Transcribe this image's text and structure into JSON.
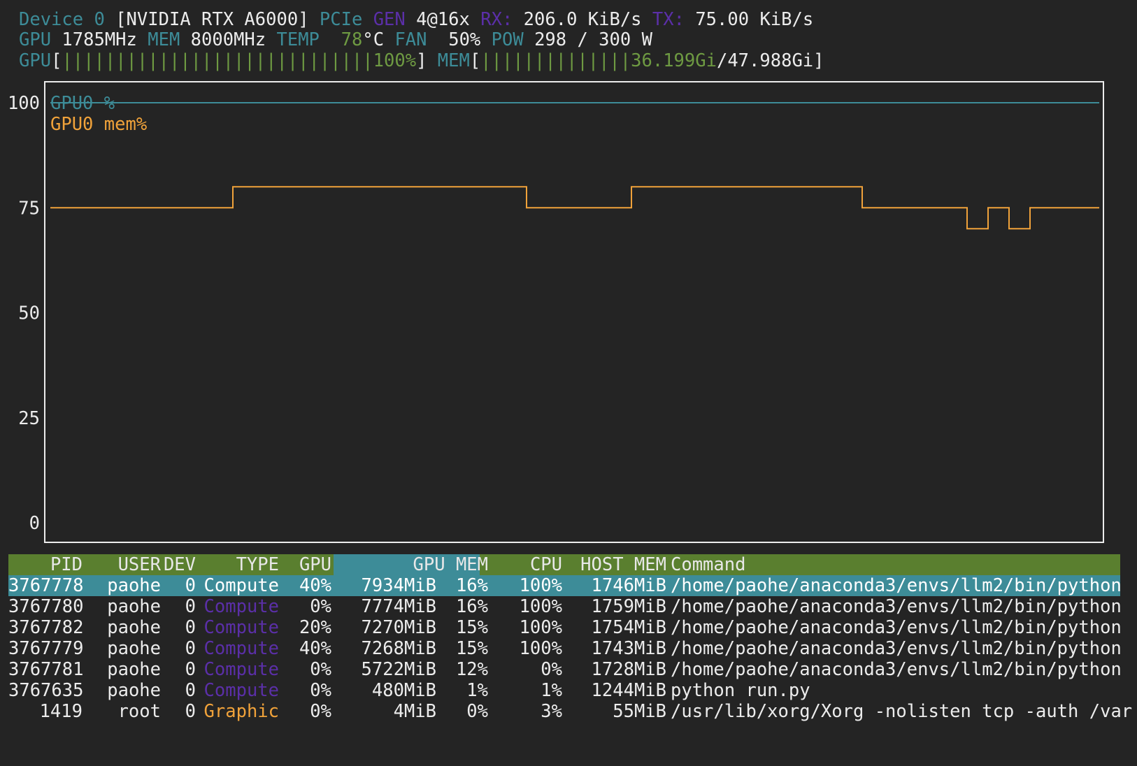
{
  "device": {
    "label": "Device",
    "index": "0",
    "name": "[NVIDIA RTX A6000]",
    "pcie_label": "PCIe",
    "gen_label": "GEN",
    "gen_value": "4@16x",
    "rx_label": "RX:",
    "rx_value": "206.0 KiB/s",
    "tx_label": "TX:",
    "tx_value": "75.00 KiB/s"
  },
  "stats": {
    "gpu_label": "GPU",
    "gpu_clock": "1785MHz",
    "mem_label": "MEM",
    "mem_clock": "8000MHz",
    "temp_label": "TEMP",
    "temp_value": "78",
    "temp_unit": "°C",
    "fan_label": "FAN",
    "fan_value": "50%",
    "pow_label": "POW",
    "pow_value": "298 / 300 W"
  },
  "bars": {
    "gpu_label": "GPU",
    "gpu_fill": "|||||||||||||||||||||||||||||",
    "gpu_percent": "100%",
    "gpu_level": 1.0,
    "mem_label": "MEM",
    "mem_fill": "||||||||||||||",
    "mem_used": "36.199Gi",
    "mem_total": "47.988Gi"
  },
  "chart_data": {
    "type": "line",
    "xlabel": "",
    "ylabel": "",
    "ylim": [
      0,
      100
    ],
    "yticks": [
      "100",
      "75",
      "50",
      "25",
      "0"
    ],
    "legend_placement": "top-left",
    "grid": false,
    "series": [
      {
        "name": "GPU0 %",
        "color": "#3d8c98",
        "x": [
          0,
          100
        ],
        "y": [
          100,
          100
        ]
      },
      {
        "name": "GPU0 mem%",
        "color": "#f0a23a",
        "x": [
          0,
          17.4,
          17.4,
          45.4,
          45.4,
          55.4,
          55.4,
          77.4,
          77.4,
          87.4,
          87.4,
          89.4,
          89.4,
          91.4,
          91.4,
          93.4,
          93.4,
          100
        ],
        "y": [
          75,
          75,
          80,
          80,
          75,
          75,
          80,
          80,
          75,
          75,
          70,
          70,
          75,
          75,
          70,
          70,
          75,
          75
        ]
      }
    ]
  },
  "process_table": {
    "headers": {
      "pid": "PID",
      "user": "USER",
      "dev": "DEV",
      "type": "TYPE",
      "gpu": "GPU",
      "gpu_mem": "GPU MEM",
      "mem_pct": "",
      "cpu": "CPU",
      "host_mem": "HOST MEM",
      "command": "Command"
    },
    "rows": [
      {
        "pid": "3767778",
        "user": "paohe",
        "dev": "0",
        "type": "Compute",
        "gpu": "40%",
        "gpu_mem": "7934MiB",
        "mem_pct": "16%",
        "cpu": "100%",
        "host_mem": "1746MiB",
        "command": "/home/paohe/anaconda3/envs/llm2/bin/python"
      },
      {
        "pid": "3767780",
        "user": "paohe",
        "dev": "0",
        "type": "Compute",
        "gpu": "0%",
        "gpu_mem": "7774MiB",
        "mem_pct": "16%",
        "cpu": "100%",
        "host_mem": "1759MiB",
        "command": "/home/paohe/anaconda3/envs/llm2/bin/python"
      },
      {
        "pid": "3767782",
        "user": "paohe",
        "dev": "0",
        "type": "Compute",
        "gpu": "20%",
        "gpu_mem": "7270MiB",
        "mem_pct": "15%",
        "cpu": "100%",
        "host_mem": "1754MiB",
        "command": "/home/paohe/anaconda3/envs/llm2/bin/python"
      },
      {
        "pid": "3767779",
        "user": "paohe",
        "dev": "0",
        "type": "Compute",
        "gpu": "40%",
        "gpu_mem": "7268MiB",
        "mem_pct": "15%",
        "cpu": "100%",
        "host_mem": "1743MiB",
        "command": "/home/paohe/anaconda3/envs/llm2/bin/python"
      },
      {
        "pid": "3767781",
        "user": "paohe",
        "dev": "0",
        "type": "Compute",
        "gpu": "0%",
        "gpu_mem": "5722MiB",
        "mem_pct": "12%",
        "cpu": "0%",
        "host_mem": "1728MiB",
        "command": "/home/paohe/anaconda3/envs/llm2/bin/python"
      },
      {
        "pid": "3767635",
        "user": "paohe",
        "dev": "0",
        "type": "Compute",
        "gpu": "0%",
        "gpu_mem": "480MiB",
        "mem_pct": "1%",
        "cpu": "1%",
        "host_mem": "1244MiB",
        "command": "python run.py"
      },
      {
        "pid": "1419",
        "user": "root",
        "dev": "0",
        "type": "Graphic",
        "gpu": "0%",
        "gpu_mem": "4MiB",
        "mem_pct": "0%",
        "cpu": "3%",
        "host_mem": "55MiB",
        "command": "/usr/lib/xorg/Xorg -nolisten tcp -auth /var"
      }
    ],
    "selected_index": 0
  },
  "colors": {
    "background": "#242424",
    "teal": "#3d8c98",
    "purple": "#5b2fa8",
    "green": "#6e9a42",
    "orange": "#f0a23a",
    "text": "#ececec"
  }
}
